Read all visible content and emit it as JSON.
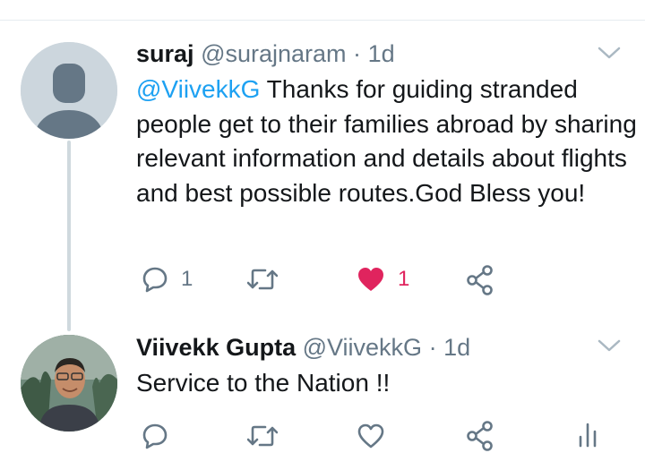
{
  "tweets": [
    {
      "name": "suraj",
      "handle": "@surajnaram",
      "separator": "·",
      "time": "1d",
      "mention": "@ViivekkG",
      "text": " Thanks for guiding stranded people get to their families abroad by sharing relevant information and details about flights and best possible routes.God Bless you!",
      "reply_count": "1",
      "like_count": "1",
      "liked": true
    },
    {
      "name": "Viivekk Gupta",
      "handle": "@ViivekkG",
      "separator": "·",
      "time": "1d",
      "text": "Service to the Nation !!",
      "reply_count": "",
      "like_count": "",
      "liked": false
    }
  ],
  "colors": {
    "accent": "#1da1f2",
    "like": "#e0245e",
    "muted": "#657786",
    "thread_line": "#cfd9de"
  },
  "icons": [
    "reply-icon",
    "retweet-icon",
    "heart-icon",
    "share-icon",
    "analytics-icon",
    "chevron-down-icon"
  ]
}
